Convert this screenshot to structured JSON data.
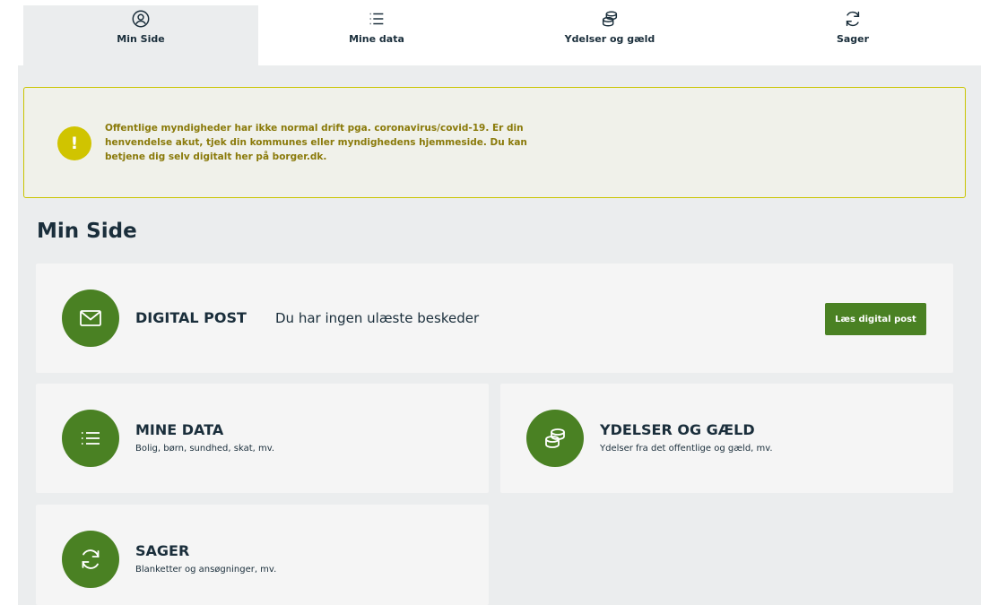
{
  "nav": {
    "tabs": [
      {
        "label": "Min Side",
        "icon": "user-icon",
        "active": true
      },
      {
        "label": "Mine data",
        "icon": "list-icon",
        "active": false
      },
      {
        "label": "Ydelser og gæld",
        "icon": "coins-icon",
        "active": false
      },
      {
        "label": "Sager",
        "icon": "refresh-icon",
        "active": false
      }
    ]
  },
  "alert": {
    "icon": "exclamation-icon",
    "badge": "!",
    "text": "Offentlige myndigheder har ikke normal drift pga. coronavirus/covid-19. Er din henvendelse akut, tjek din kommunes eller myndighedens hjemmeside. Du kan betjene dig selv digitalt her på borger.dk."
  },
  "page": {
    "title": "Min Side"
  },
  "cards": {
    "post": {
      "title": "DIGITAL POST",
      "desc": "Du har ingen ulæste beskeder",
      "button": "Læs digital post",
      "icon": "envelope-icon"
    },
    "data": {
      "title": "MINE DATA",
      "desc": "Bolig, børn, sundhed, skat, mv.",
      "icon": "list-icon"
    },
    "ydelser": {
      "title": "YDELSER OG GÆLD",
      "desc": "Ydelser fra det offentlige og gæld, mv.",
      "icon": "coins-icon"
    },
    "sager": {
      "title": "SAGER",
      "desc": "Blanketter og ansøgninger, mv.",
      "icon": "refresh-icon"
    }
  },
  "colors": {
    "accent": "#4a8123",
    "alert_border": "#c9c400",
    "alert_text": "#8a7a0a",
    "background": "#ebedee",
    "card": "#f5f5f5",
    "text": "#1a2e3b"
  }
}
